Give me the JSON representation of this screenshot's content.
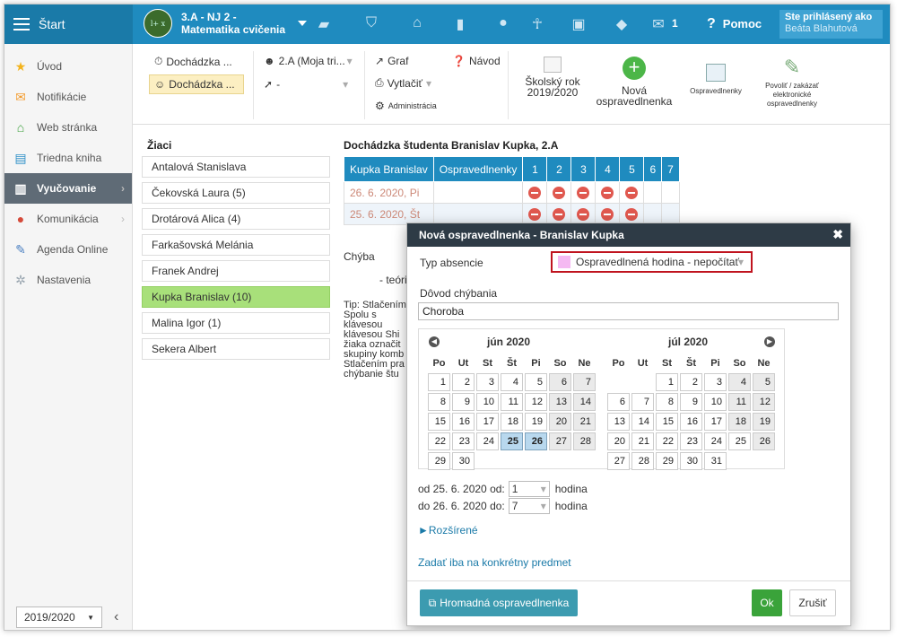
{
  "top": {
    "start": "Štart",
    "class_line1": "3.A - NJ 2 -",
    "class_line2": "Matematika cvičenia",
    "avatar": "l+ x",
    "mail_count": "1",
    "help": "Pomoc",
    "user_line1": "Ste prihlásený ako",
    "user_line2": "Beáta Blahutová"
  },
  "sidebar": {
    "items": [
      {
        "label": "Úvod",
        "icon": "star-icon",
        "color": "#f3b31d"
      },
      {
        "label": "Notifikácie",
        "icon": "envelope-icon",
        "color": "#f39c2d"
      },
      {
        "label": "Web stránka",
        "icon": "home-icon",
        "color": "#3ca03b"
      },
      {
        "label": "Triedna kniha",
        "icon": "book-icon",
        "color": "#2d8fc7"
      },
      {
        "label": "Vyučovanie",
        "icon": "open-book-icon",
        "color": "#ffffff"
      },
      {
        "label": "Komunikácia",
        "icon": "chat-icon",
        "color": "#d54a3a"
      },
      {
        "label": "Agenda Online",
        "icon": "pen-icon",
        "color": "#4a7fc1"
      },
      {
        "label": "Nastavenia",
        "icon": "gear-icon",
        "color": "#9aa6b0"
      }
    ],
    "year": "2019/2020"
  },
  "toolbar": {
    "dochadzka1": "Dochádzka ...",
    "dochadzka2": "Dochádzka ...",
    "group": "2.A (Moja tri...",
    "dash": "-",
    "graf": "Graf",
    "vytlacit": "Vytlačiť",
    "administracia": "Administrácia",
    "navod": "Návod",
    "skolsky1": "Školský rok",
    "skolsky2": "2019/2020",
    "nova1": "Nová",
    "nova2": "ospravedlnenka",
    "ospravedlnenky": "Ospravedlnenky",
    "povolit1": "Povoliť / zakázať",
    "povolit2": "elektronické",
    "povolit3": "ospravedlnenky"
  },
  "students": {
    "title": "Žiaci",
    "list": [
      "Antalová Stanislava",
      "Čekovská Laura (5)",
      "Drotárová Alica (4)",
      "Farkašovská Melánia",
      "Franek Andrej",
      "Kupka Branislav (10)",
      "Malina Igor (1)",
      "Sekera Albert"
    ]
  },
  "attendance": {
    "title": "Dochádzka študenta Branislav Kupka, 2.A",
    "headers": [
      "Kupka Branislav",
      "Ospravedlnenky",
      "1",
      "2",
      "3",
      "4",
      "5",
      "6",
      "7"
    ],
    "rows": [
      "26. 6. 2020, Pi",
      "25. 6. 2020, Št"
    ],
    "chyba": "Chýba",
    "teoria": "- teória",
    "tip": "Tip: Stlačením Spolu s klávesou klávesou Shi žiaka označit skupiny komb Stlačením pra chýbanie štu"
  },
  "modal": {
    "title": "Nová ospravedlnenka - Branislav Kupka",
    "typ_label": "Typ absencie",
    "typ_value": "Ospravedlnená hodina - nepočítať",
    "dovod_label": "Dôvod chýbania",
    "dovod_value": "Choroba",
    "months": [
      {
        "name": "jún 2020"
      },
      {
        "name": "júl 2020"
      }
    ],
    "weekdays": [
      "Po",
      "Ut",
      "St",
      "Št",
      "Pi",
      "So",
      "Ne"
    ],
    "od_label": "od 25. 6. 2020 od:",
    "od_value": "1",
    "do_label": "do 26. 6. 2020 do:",
    "do_value": "7",
    "hodina": "hodina",
    "rozsirene": "►Rozšírené",
    "zadat": "Zadať iba na konkrétny predmet",
    "hromadna": "Hromadná ospravedlnenka",
    "ok": "Ok",
    "zrusit": "Zrušiť"
  }
}
